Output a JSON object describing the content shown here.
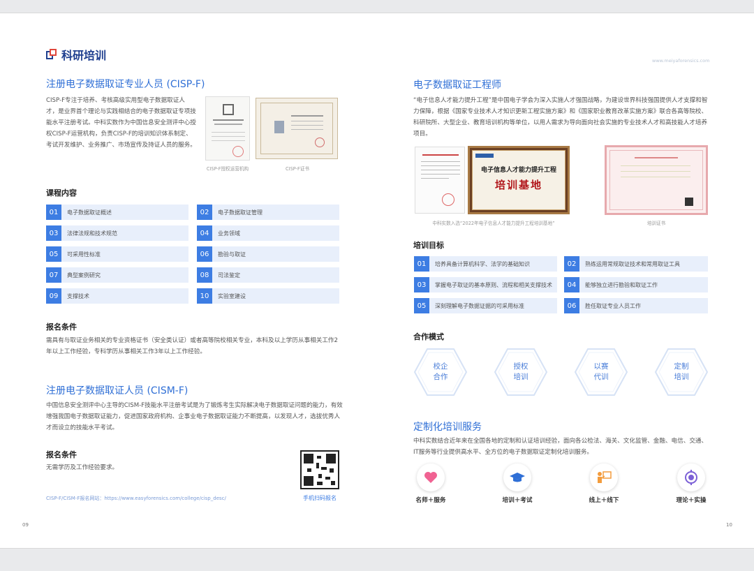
{
  "left": {
    "brand": "科研培训",
    "sec1_title": "注册电子数据取证专业人员 (CISP-F)",
    "sec1_body": "CISP-F专注于培养、考核高级实用型电子数据取证人才，是业界首个理论与实践相结合的电子数据取证专项技能水平注册考试。中科实数作为中国信息安全测评中心授权CISP-F运营机构，负责CISP-F的培训知识体系制定、考试开发维护、业务推广、市场宣传及持证人员的服务。",
    "cert_caption_1": "CISP-F授权运营机构",
    "cert_caption_2": "CISP-F证书",
    "courses_heading": "课程内容",
    "courses": [
      {
        "num": "01",
        "label": "电子数据取证概述"
      },
      {
        "num": "02",
        "label": "电子数据取证管理"
      },
      {
        "num": "03",
        "label": "法律法规和技术规范"
      },
      {
        "num": "04",
        "label": "业务领域"
      },
      {
        "num": "05",
        "label": "可采用性标准"
      },
      {
        "num": "06",
        "label": "勘验与取证"
      },
      {
        "num": "07",
        "label": "典型案例研究"
      },
      {
        "num": "08",
        "label": "司法鉴定"
      },
      {
        "num": "09",
        "label": "支撑技术"
      },
      {
        "num": "10",
        "label": "实验室建设"
      }
    ],
    "req1_heading": "报名条件",
    "req1_body": "需具有与取证业务相关的专业资格证书（安全类认证）或者高等院校相关专业，本科及以上学历从事相关工作2年以上工作经验，专科学历从事相关工作3年以上工作经验。",
    "sec2_title": "注册电子数据取证人员 (CISM-F)",
    "sec2_body": "中国信息安全测评中心主导的CISM-F技能水平注册考试是为了锻炼考生实际解决电子数据取证问题的能力，有效增强我国电子数据取证能力，促进国家政府机构、企事业电子数据取证能力不断提高，以发现人才，选拔优秀人才而设立的技能水平考试。",
    "req2_heading": "报名条件",
    "req2_body": "无需学历及工作经验要求。",
    "footer_link": "CISP-F/CISM-F报名网站：https://www.easyforensics.com/college/cisp_desc/",
    "qr_caption": "手机扫码报名",
    "page_num": "09"
  },
  "right": {
    "url": "www.meiyaforensics.com",
    "title": "电子数据取证工程师",
    "body": "“电子信息人才能力提升工程”是中国电子学会为深入实施人才强国战略，为建设世界科技强国提供人才支撑和智力保障，根据《国家专业技术人才知识更新工程实施方案》和《国家职业教育改革实施方案》联合各高等院校、科研院所、大型企业、教育培训机构等单位，以用人需求为导向面向社会实施的专业技术人才和高技能人才培养项目。",
    "plaque_line1": "电子信息人才能力提升工程",
    "plaque_line2": "培训基地",
    "cert_caption_1": "中科实数入选“2022年电子信息人才能力提升工程培训基地”",
    "cert_caption_2": "培训证书",
    "goals_heading": "培训目标",
    "goals": [
      {
        "num": "01",
        "label": "培养具备计算机科学、法学的基础知识"
      },
      {
        "num": "02",
        "label": "熟练运用常规取证技术和常用取证工具"
      },
      {
        "num": "03",
        "label": "掌握电子取证的基本原则、流程和相关支撑技术"
      },
      {
        "num": "04",
        "label": "能够独立进行勘验和取证工作"
      },
      {
        "num": "05",
        "label": "深刻理解电子数据证据的可采用标准"
      },
      {
        "num": "06",
        "label": "胜任取证专业人员工作"
      }
    ],
    "coop_heading": "合作模式",
    "coop": [
      {
        "line1": "校企",
        "line2": "合作"
      },
      {
        "line1": "授权",
        "line2": "培训"
      },
      {
        "line1": "以赛",
        "line2": "代训"
      },
      {
        "line1": "定制",
        "line2": "培训"
      }
    ],
    "custom_title": "定制化培训服务",
    "custom_body": "中科实数结合近年来在全国各地的定制和认证培训经验，面向各公检法、海关、文化监管、金融、电信、交通、IT服务等行业提供高水平、全方位的电子数据取证定制化培训服务。",
    "services": [
      {
        "icon": "heart-icon",
        "label": "名师＋服务"
      },
      {
        "icon": "graduation-cap-icon",
        "label": "培训＋考试"
      },
      {
        "icon": "presentation-icon",
        "label": "线上＋线下"
      },
      {
        "icon": "target-icon",
        "label": "理论＋实操"
      }
    ],
    "page_num": "10",
    "colors": {
      "accent": "#3d7de3",
      "tile_bg": "#e8effb",
      "brand": "#1f3f8f"
    }
  }
}
